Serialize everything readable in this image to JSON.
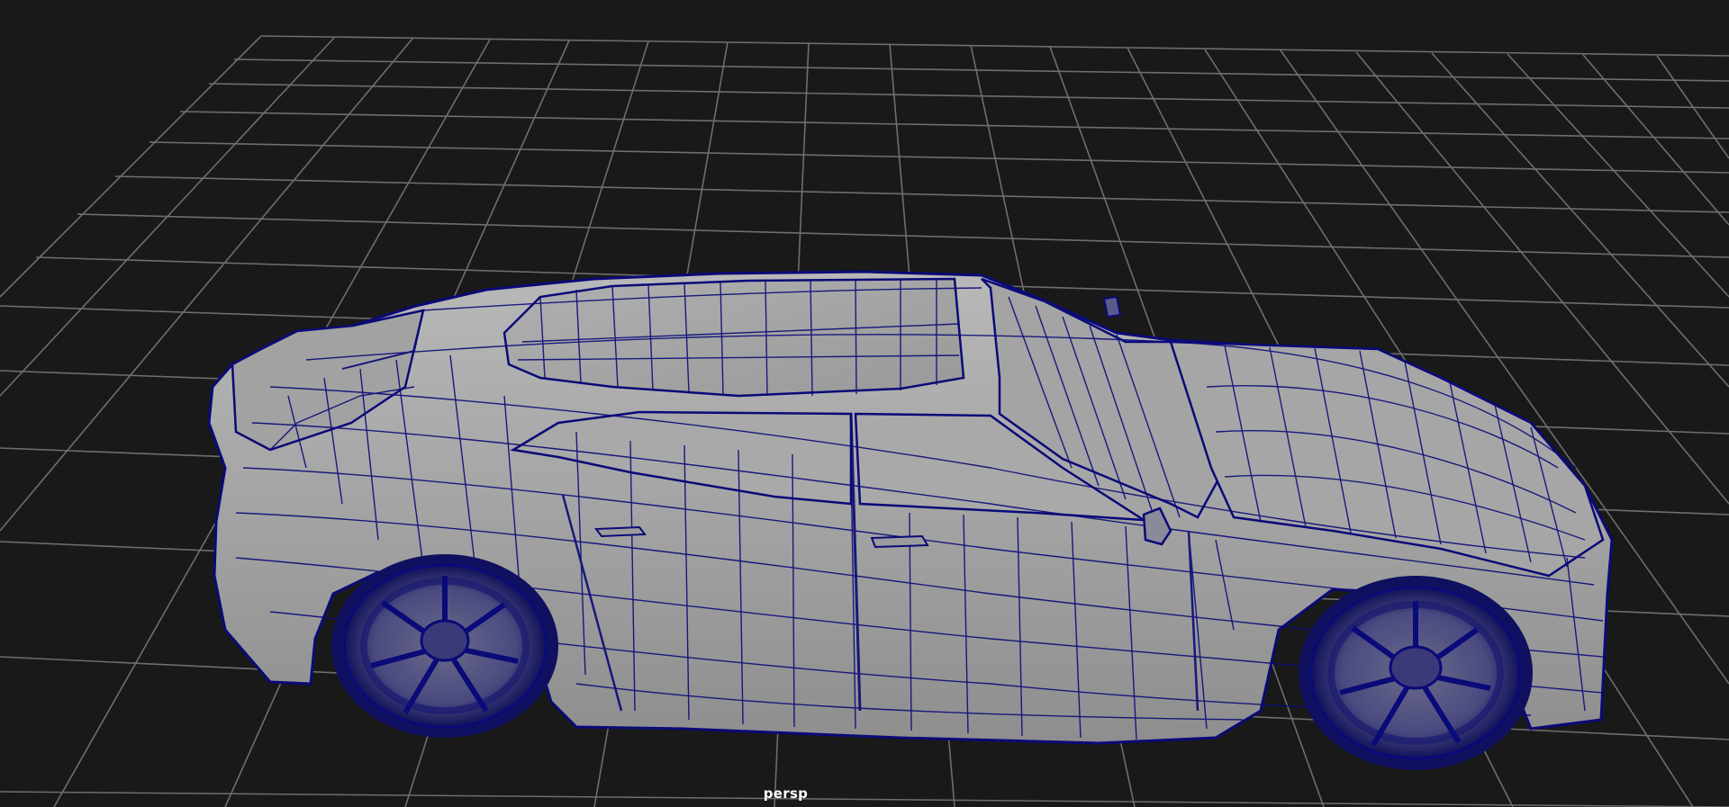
{
  "viewport": {
    "camera_label": "persp",
    "grid_color": "#7a7a7a",
    "wire_color": "#0a0a78",
    "body_color": "#a8a8a8"
  },
  "scene": {
    "object": "car-model-wireframe",
    "display_mode": "wireframe-on-shaded"
  }
}
